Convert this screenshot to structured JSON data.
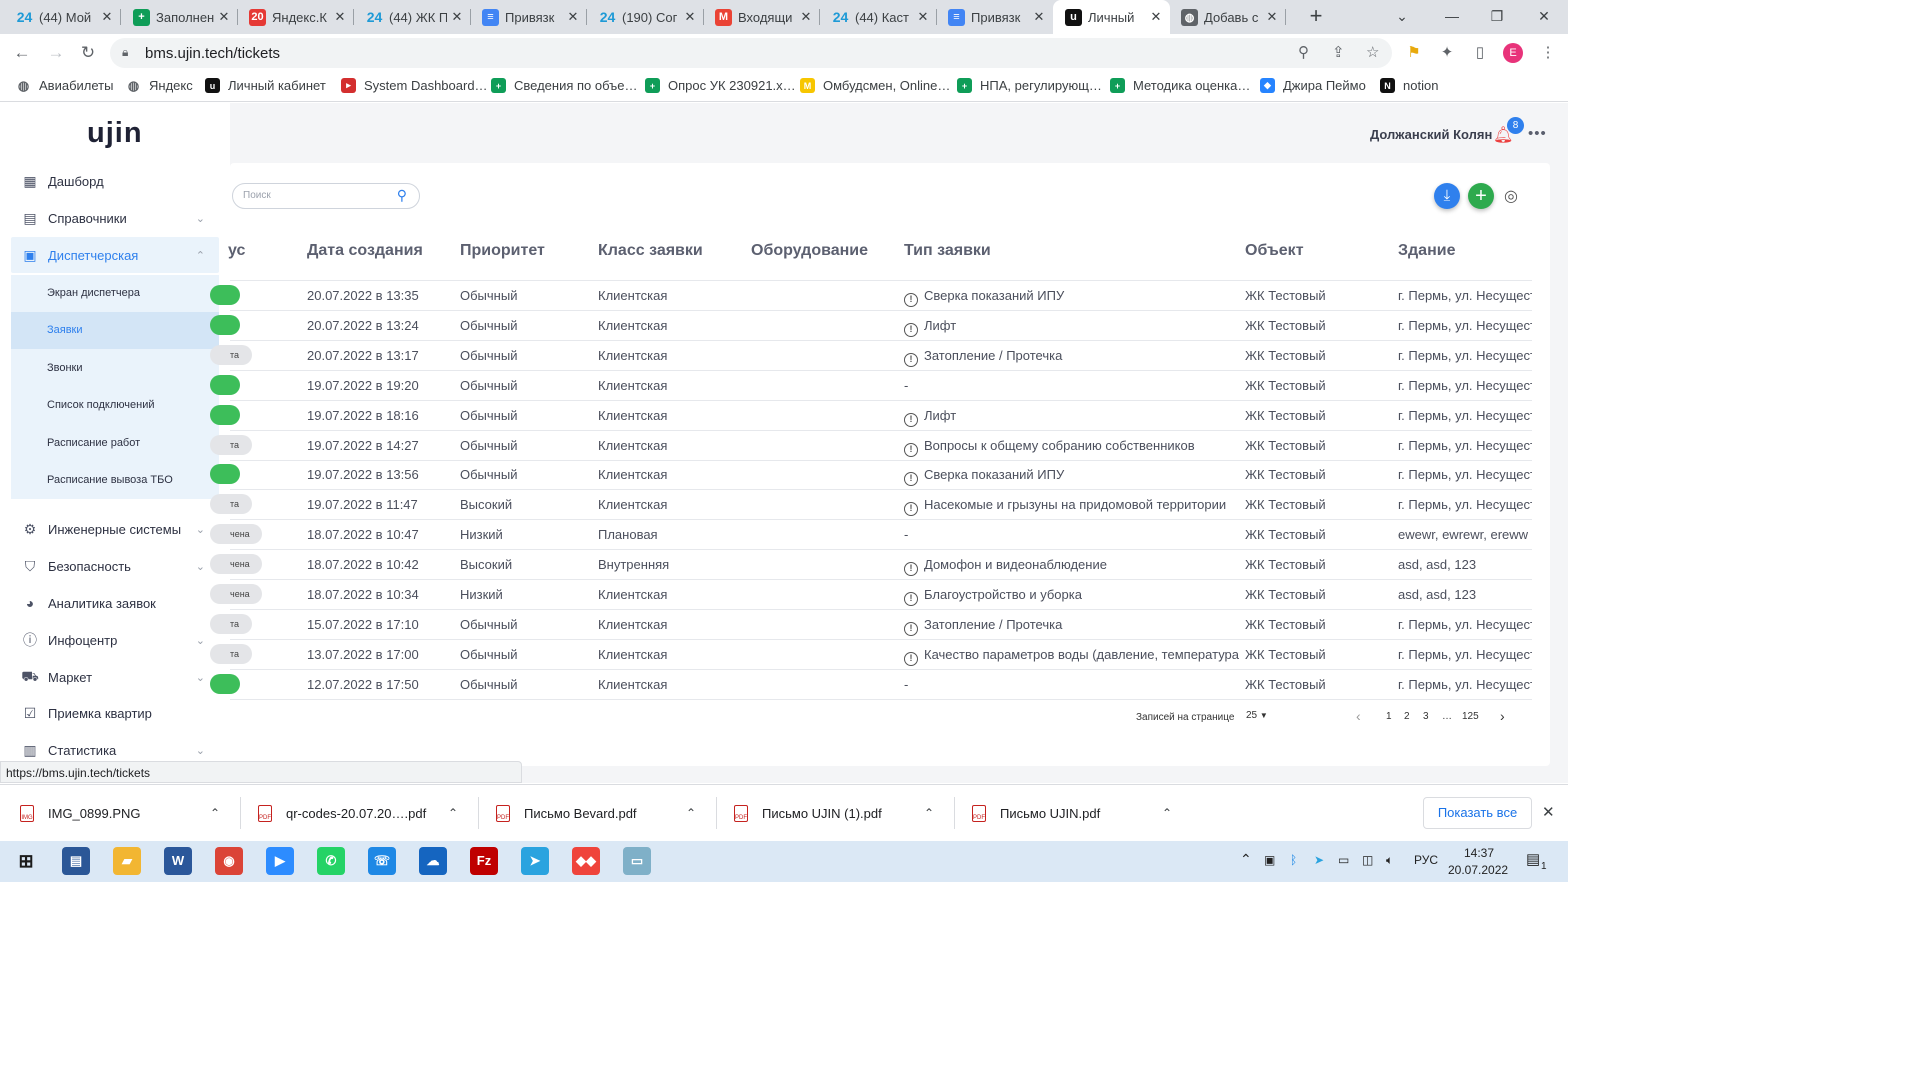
{
  "browser": {
    "tabs": [
      {
        "title": "(44) Мой",
        "icon": "bitrix24-icon",
        "color": "#2fc6f6",
        "glyph": "24"
      },
      {
        "title": "Заполнен",
        "icon": "google-sheets-icon",
        "color": "#0f9d58",
        "glyph": "+"
      },
      {
        "title": "Яндекс.К",
        "icon": "yandex-calendar-icon",
        "color": "#e53935",
        "glyph": "20"
      },
      {
        "title": "(44) ЖК П",
        "icon": "bitrix24-icon",
        "color": "#2fc6f6",
        "glyph": "24"
      },
      {
        "title": "Привязк",
        "icon": "google-docs-icon",
        "color": "#4285f4",
        "glyph": "≡"
      },
      {
        "title": "(190) Сог",
        "icon": "bitrix24-icon",
        "color": "#2fc6f6",
        "glyph": "24"
      },
      {
        "title": "Входящи",
        "icon": "gmail-icon",
        "color": "#ea4335",
        "glyph": "M"
      },
      {
        "title": "(44) Каст",
        "icon": "bitrix24-icon",
        "color": "#2fc6f6",
        "glyph": "24"
      },
      {
        "title": "Привязк",
        "icon": "google-docs-icon",
        "color": "#4285f4",
        "glyph": "≡"
      },
      {
        "title": "Личный",
        "icon": "ujin-icon",
        "color": "#111111",
        "glyph": "u"
      },
      {
        "title": "Добавь с",
        "icon": "globe-icon",
        "color": "#5f6368",
        "glyph": "◍"
      }
    ],
    "url": "bms.ujin.tech/tickets",
    "status_url": "https://bms.ujin.tech/tickets",
    "profile_initial": "E",
    "bookmarks": [
      {
        "label": "Авиабилеты",
        "icon": "globe-icon",
        "color": "#5f6368",
        "glyph": "◍"
      },
      {
        "label": "Яндекс",
        "icon": "globe-icon",
        "color": "#5f6368",
        "glyph": "◍"
      },
      {
        "label": "Личный кабинет",
        "icon": "ujin-icon",
        "color": "#111111",
        "glyph": "u"
      },
      {
        "label": "System Dashboard…",
        "icon": "jira-icon",
        "color": "#d32f2f",
        "glyph": "▸"
      },
      {
        "label": "Сведения по объе…",
        "icon": "google-sheets-icon",
        "color": "#0f9d58",
        "glyph": "+"
      },
      {
        "label": "Опрос УК 230921.х…",
        "icon": "google-sheets-icon",
        "color": "#0f9d58",
        "glyph": "+"
      },
      {
        "label": "Омбудсмен, Online…",
        "icon": "miro-icon",
        "color": "#f7c600",
        "glyph": "M"
      },
      {
        "label": "НПА, регулирующ…",
        "icon": "google-sheets-icon",
        "color": "#0f9d58",
        "glyph": "+"
      },
      {
        "label": "Методика оценка…",
        "icon": "google-sheets-icon",
        "color": "#0f9d58",
        "glyph": "+"
      },
      {
        "label": "Джира Пеймо",
        "icon": "jira-diamond-icon",
        "color": "#2684ff",
        "glyph": "◆"
      },
      {
        "label": "notion",
        "icon": "notion-icon",
        "color": "#111111",
        "glyph": "N"
      }
    ]
  },
  "app": {
    "logo": "ujin",
    "user_name": "Должанский Колян",
    "notification_count": "8",
    "sidebar": {
      "items": [
        {
          "label": "Дашборд",
          "icon": "dashboard-icon",
          "glyph": "▦",
          "chevron": ""
        },
        {
          "label": "Справочники",
          "icon": "reference-book-icon",
          "glyph": "▤",
          "chevron": "⌄"
        },
        {
          "label": "Диспетчерская",
          "icon": "dispatcher-calendar-icon",
          "glyph": "▣",
          "chevron": "⌃"
        },
        {
          "label": "Инженерные системы",
          "icon": "engineering-gears-icon",
          "glyph": "⚙",
          "chevron": "⌄"
        },
        {
          "label": "Безопасность",
          "icon": "shield-icon",
          "glyph": "⛉",
          "chevron": "⌄"
        },
        {
          "label": "Аналитика заявок",
          "icon": "pie-chart-icon",
          "glyph": "◕",
          "chevron": ""
        },
        {
          "label": "Инфоцентр",
          "icon": "info-icon",
          "glyph": "ⓘ",
          "chevron": "⌄"
        },
        {
          "label": "Маркет",
          "icon": "cart-icon",
          "glyph": "⛟",
          "chevron": "⌄"
        },
        {
          "label": "Приемка квартир",
          "icon": "checkbox-icon",
          "glyph": "☑",
          "chevron": ""
        },
        {
          "label": "Статистика",
          "icon": "statistics-icon",
          "glyph": "▥",
          "chevron": "⌄"
        }
      ],
      "sub_items": [
        "Экран диспетчера",
        "Заявки",
        "Звонки",
        "Список подключений",
        "Расписание работ",
        "Расписание вывоза ТБО"
      ],
      "active_sub": "Заявки"
    },
    "search_placeholder": "Поиск",
    "columns": [
      "ус",
      "Дата создания",
      "Приоритет",
      "Класс заявки",
      "Оборудование",
      "Тип заявки",
      "Объект",
      "Здание"
    ],
    "rows": [
      {
        "status": "",
        "status_color": "#3dbe5a",
        "date": "20.07.2022 в 13:35",
        "priority": "Обычный",
        "class": "Клиентская",
        "equipment": "",
        "type": "Сверка показаний ИПУ",
        "has_icon": true,
        "object": "ЖК Тестовый",
        "building": "г. Пермь, ул. Несуществ"
      },
      {
        "status": "",
        "status_color": "#3dbe5a",
        "date": "20.07.2022 в 13:24",
        "priority": "Обычный",
        "class": "Клиентская",
        "equipment": "",
        "type": "Лифт",
        "has_icon": true,
        "object": "ЖК Тестовый",
        "building": "г. Пермь, ул. Несуществ"
      },
      {
        "status": "та",
        "status_color": "#e4e5e8",
        "date": "20.07.2022 в 13:17",
        "priority": "Обычный",
        "class": "Клиентская",
        "equipment": "",
        "type": "Затопление / Протечка",
        "has_icon": true,
        "object": "ЖК Тестовый",
        "building": "г. Пермь, ул. Несуществ"
      },
      {
        "status": "",
        "status_color": "#3dbe5a",
        "date": "19.07.2022 в 19:20",
        "priority": "Обычный",
        "class": "Клиентская",
        "equipment": "",
        "type": "-",
        "has_icon": false,
        "object": "ЖК Тестовый",
        "building": "г. Пермь, ул. Несуществ"
      },
      {
        "status": "",
        "status_color": "#3dbe5a",
        "date": "19.07.2022 в 18:16",
        "priority": "Обычный",
        "class": "Клиентская",
        "equipment": "",
        "type": "Лифт",
        "has_icon": true,
        "object": "ЖК Тестовый",
        "building": "г. Пермь, ул. Несуществ"
      },
      {
        "status": "та",
        "status_color": "#e4e5e8",
        "date": "19.07.2022 в 14:27",
        "priority": "Обычный",
        "class": "Клиентская",
        "equipment": "",
        "type": "Вопросы к общему собранию собственников",
        "has_icon": true,
        "object": "ЖК Тестовый",
        "building": "г. Пермь, ул. Несуществ"
      },
      {
        "status": "",
        "status_color": "#3dbe5a",
        "date": "19.07.2022 в 13:56",
        "priority": "Обычный",
        "class": "Клиентская",
        "equipment": "",
        "type": "Сверка показаний ИПУ",
        "has_icon": true,
        "object": "ЖК Тестовый",
        "building": "г. Пермь, ул. Несуществ"
      },
      {
        "status": "та",
        "status_color": "#e4e5e8",
        "date": "19.07.2022 в 11:47",
        "priority": "Высокий",
        "class": "Клиентская",
        "equipment": "",
        "type": "Насекомые и грызуны на придомовой территории",
        "has_icon": true,
        "object": "ЖК Тестовый",
        "building": "г. Пермь, ул. Несуществ"
      },
      {
        "status": "чена",
        "status_color": "#e4e5e8",
        "date": "18.07.2022 в 10:47",
        "priority": "Низкий",
        "class": "Плановая",
        "equipment": "",
        "type": "-",
        "has_icon": false,
        "object": "ЖК Тестовый",
        "building": "ewewr, ewrewr, ereww"
      },
      {
        "status": "чена",
        "status_color": "#e4e5e8",
        "date": "18.07.2022 в 10:42",
        "priority": "Высокий",
        "class": "Внутренняя",
        "equipment": "",
        "type": "Домофон и видеонаблюдение",
        "has_icon": true,
        "object": "ЖК Тестовый",
        "building": "asd, asd, 123"
      },
      {
        "status": "чена",
        "status_color": "#e4e5e8",
        "date": "18.07.2022 в 10:34",
        "priority": "Низкий",
        "class": "Клиентская",
        "equipment": "",
        "type": "Благоустройство и уборка",
        "has_icon": true,
        "object": "ЖК Тестовый",
        "building": "asd, asd, 123"
      },
      {
        "status": "та",
        "status_color": "#e4e5e8",
        "date": "15.07.2022 в 17:10",
        "priority": "Обычный",
        "class": "Клиентская",
        "equipment": "",
        "type": "Затопление / Протечка",
        "has_icon": true,
        "object": "ЖК Тестовый",
        "building": "г. Пермь, ул. Несуществ"
      },
      {
        "status": "та",
        "status_color": "#e4e5e8",
        "date": "13.07.2022 в 17:00",
        "priority": "Обычный",
        "class": "Клиентская",
        "equipment": "",
        "type": "Качество параметров воды (давление, температура)",
        "has_icon": true,
        "object": "ЖК Тестовый",
        "building": "г. Пермь, ул. Несуществ"
      },
      {
        "status": "",
        "status_color": "#3dbe5a",
        "date": "12.07.2022 в 17:50",
        "priority": "Обычный",
        "class": "Клиентская",
        "equipment": "",
        "type": "-",
        "has_icon": false,
        "object": "ЖК Тестовый",
        "building": "г. Пермь, ул. Несуществ"
      }
    ],
    "pagination": {
      "per_page_label": "Записей на странице",
      "per_page": "25",
      "pages": [
        "1",
        "2",
        "3",
        "…",
        "125"
      ]
    },
    "accent_color": "#2f80ed",
    "add_color": "#2eaa4e"
  },
  "downloads": {
    "items": [
      "IMG_0899.PNG",
      "qr-codes-20.07.20….pdf",
      "Письмо Bevard.pdf",
      "Письмо UJIN (1).pdf",
      "Письмо UJIN.pdf"
    ],
    "show_all": "Показать все"
  },
  "taskbar": {
    "lang": "РУС",
    "time": "14:37",
    "date": "20.07.2022",
    "notif_count": "1",
    "apps": [
      {
        "name": "file-manager-icon",
        "color": "#2b5797",
        "glyph": "▤"
      },
      {
        "name": "explorer-folder-icon",
        "color": "#f2b632",
        "glyph": "▰"
      },
      {
        "name": "word-icon",
        "color": "#2b579a",
        "glyph": "W"
      },
      {
        "name": "chrome-icon",
        "color": "#db4437",
        "glyph": "◉"
      },
      {
        "name": "zoom-icon",
        "color": "#2d8cff",
        "glyph": "▶"
      },
      {
        "name": "whatsapp-icon",
        "color": "#25d366",
        "glyph": "✆"
      },
      {
        "name": "phone-icon",
        "color": "#1e88e5",
        "glyph": "☏"
      },
      {
        "name": "onedrive-icon",
        "color": "#1565c0",
        "glyph": "☁"
      },
      {
        "name": "filezilla-icon",
        "color": "#bf0000",
        "glyph": "Fz"
      },
      {
        "name": "telegram-icon",
        "color": "#2aa3df",
        "glyph": "➤"
      },
      {
        "name": "anydesk-icon",
        "color": "#ef443b",
        "glyph": "◆◆"
      },
      {
        "name": "notes-icon",
        "color": "#7fb0c8",
        "glyph": "▭"
      }
    ]
  }
}
